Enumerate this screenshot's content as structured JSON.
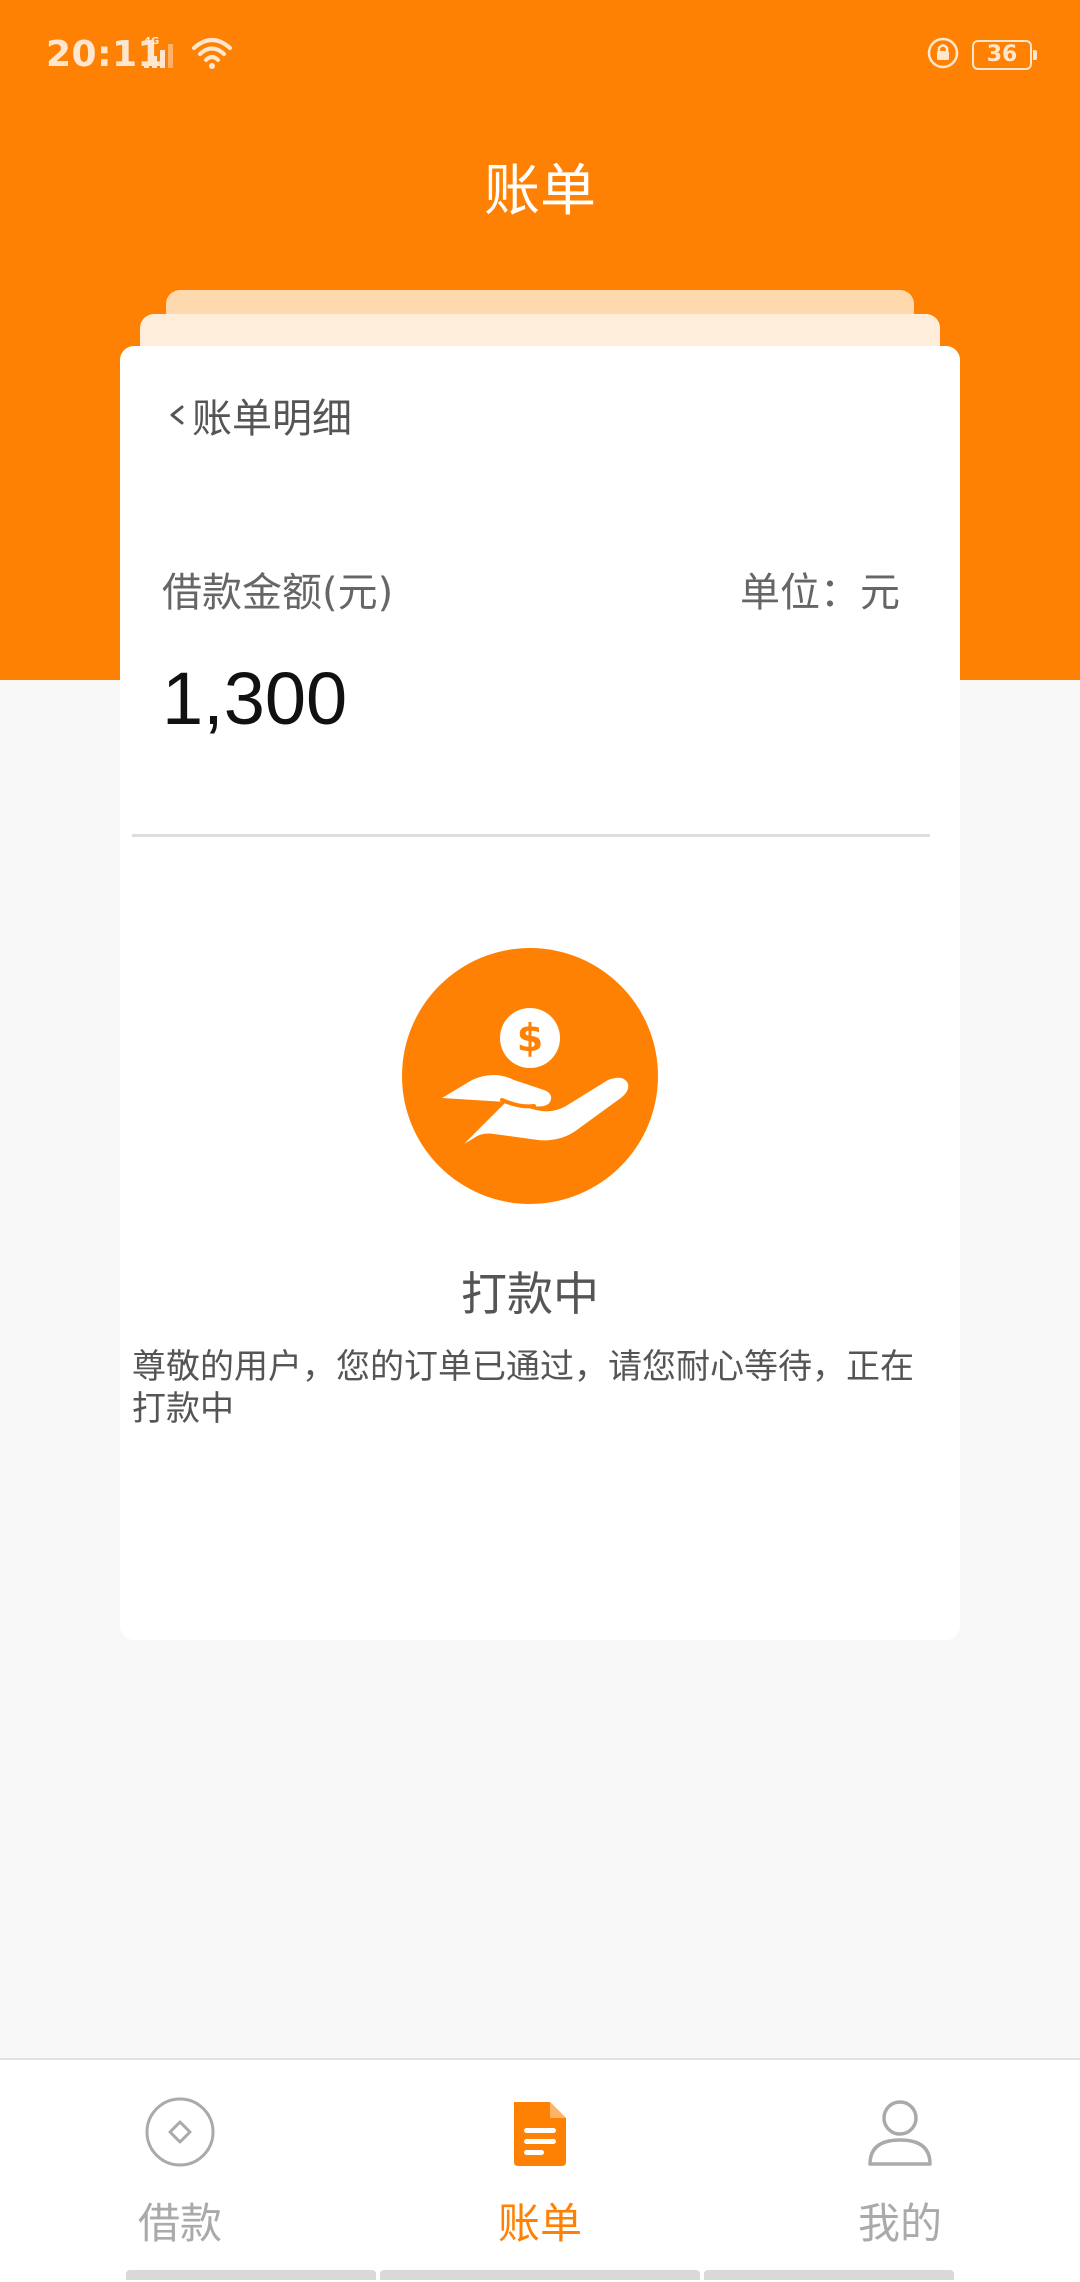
{
  "status_bar": {
    "time": "20:11",
    "network": "4G",
    "battery": "36"
  },
  "header": {
    "title": "账单"
  },
  "bill_card": {
    "back_label": "账单明细",
    "amount_label": "借款金额(元)",
    "unit_label": "单位：元",
    "amount_value": "1,300",
    "status_title": "打款中",
    "status_desc": "尊敬的用户，您的订单已通过，请您耐心等待，正在打款中"
  },
  "bottom_nav": {
    "items": [
      {
        "label": "借款",
        "icon": "diamond-circle-icon",
        "active": false
      },
      {
        "label": "账单",
        "icon": "document-icon",
        "active": true
      },
      {
        "label": "我的",
        "icon": "user-icon",
        "active": false
      }
    ]
  },
  "colors": {
    "accent": "#ff8104",
    "inactive": "#aaaaaa",
    "background": "#f8f8f8"
  }
}
